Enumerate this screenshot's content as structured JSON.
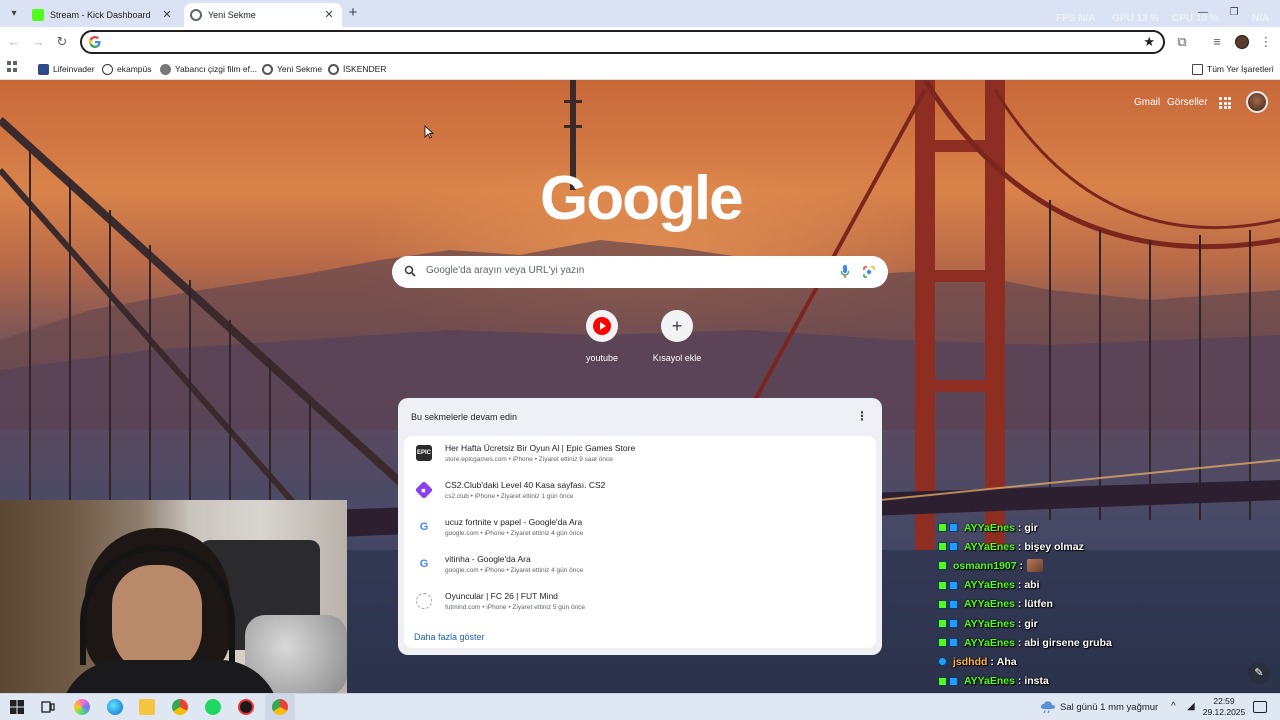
{
  "tabs": [
    {
      "title": "Stream - Kick Dashboard",
      "active": false,
      "favicon_color": "#53fc18"
    },
    {
      "title": "Yeni Sekme",
      "active": true,
      "favicon_color": "#5f6368"
    }
  ],
  "overlay_stats": {
    "fps_label": "FPS",
    "fps_value": "N/A",
    "gpu_label": "GPU",
    "gpu_value": "13 %",
    "cpu_label": "CPU",
    "cpu_value": "10 %",
    "extra_value": "N/A"
  },
  "omnibox": {
    "value": "",
    "placeholder": ""
  },
  "bookmarks": [
    {
      "label": "Lifeinvader",
      "icon": "lifeinvader-icon"
    },
    {
      "label": "ekampüs",
      "icon": "ekampus-icon"
    },
    {
      "label": "Yabancı çizgi film ef...",
      "icon": "cartoon-icon"
    },
    {
      "label": "Yeni Sekme",
      "icon": "chrome-icon"
    },
    {
      "label": "İSKENDER",
      "icon": "chrome-icon"
    }
  ],
  "all_bookmarks_label": "Tüm Yer İşaretleri",
  "ntp": {
    "gmail": "Gmail",
    "images": "Görseller",
    "logo": "Google",
    "search_placeholder": "Google'da arayın veya URL'yi yazın",
    "shortcuts": [
      {
        "label": "youtube",
        "icon": "youtube-icon"
      },
      {
        "label": "Kısayol ekle",
        "icon": "plus-icon"
      }
    ],
    "continue": {
      "title": "Bu sekmelerle devam edin",
      "items": [
        {
          "title": "Her Hafta Ücretsiz Bir Oyun Al | Epic Games Store",
          "meta": "store.epicgames.com • iPhone • Ziyaret ettiniz 9 saat önce",
          "icon": "epic-games-icon"
        },
        {
          "title": "CS2.Club'daki Level 40 Kasa sayfası. CS2",
          "meta": "cs2.club • iPhone • Ziyaret ettiniz 1 gün önce",
          "icon": "cs2club-icon"
        },
        {
          "title": "ucuz fortnite v papel - Google'da Ara",
          "meta": "google.com • iPhone • Ziyaret ettiniz 4 gün önce",
          "icon": "google-icon"
        },
        {
          "title": "vitinha - Google'da Ara",
          "meta": "google.com • iPhone • Ziyaret ettiniz 4 gün önce",
          "icon": "google-icon"
        },
        {
          "title": "Oyuncular | FC 26 | FUT Mind",
          "meta": "futmind.com • iPhone • Ziyaret ettiniz 5 gün önce",
          "icon": "futmind-icon"
        }
      ],
      "more": "Daha fazla göster"
    }
  },
  "chat": [
    {
      "user": "AYYaEnes",
      "message": "gir",
      "color": "green"
    },
    {
      "user": "AYYaEnes",
      "message": "bişey olmaz",
      "color": "green"
    },
    {
      "user": "osmann1907",
      "message": "",
      "color": "green",
      "emote": true
    },
    {
      "user": "AYYaEnes",
      "message": "abi",
      "color": "green"
    },
    {
      "user": "AYYaEnes",
      "message": "lütfen",
      "color": "green"
    },
    {
      "user": "AYYaEnes",
      "message": "gir",
      "color": "green"
    },
    {
      "user": "AYYaEnes",
      "message": "abi girsene gruba",
      "color": "green"
    },
    {
      "user": "jsdhdd",
      "message": "Aha",
      "color": "orange"
    },
    {
      "user": "AYYaEnes",
      "message": "insta",
      "color": "green"
    }
  ],
  "taskbar": {
    "weather": "Sal günü 1 mm yağmur",
    "time": "22:59",
    "date": "29.12.2025"
  }
}
